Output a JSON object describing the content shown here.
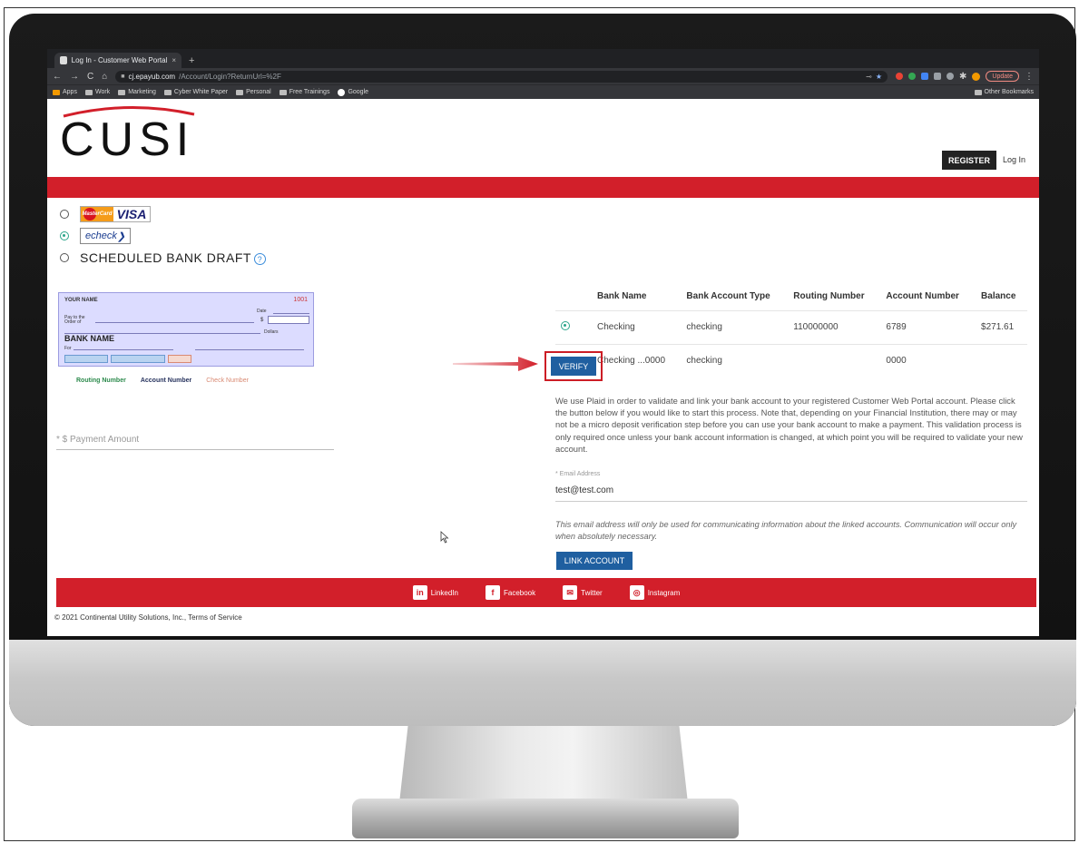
{
  "browser": {
    "tab_title": "Log In - Customer Web Portal",
    "tab_close": "×",
    "new_tab": "+",
    "url_host": "cj.epayub.com",
    "url_path": "/Account/Login?ReturnUrl=%2F",
    "update_label": "Update",
    "bookmarks": [
      "Apps",
      "Work",
      "Marketing",
      "Cyber White Paper",
      "Personal",
      "Free Trainings",
      "Google"
    ],
    "other_bookmarks": "Other Bookmarks"
  },
  "header": {
    "logo_text": "CUSI",
    "register_label": "REGISTER",
    "login_label": "Log In"
  },
  "payment_methods": {
    "card_brand_1": "MasterCard",
    "card_brand_2": "VISA",
    "echeck_label": "echeck",
    "draft_label": "SCHEDULED BANK DRAFT",
    "selected": "echeck"
  },
  "check_image": {
    "name": "YOUR NAME",
    "number": "1001",
    "date_label": "Date",
    "pay_label": "Pay to the Order of",
    "dollars_label": "Dollars",
    "bank_name": "BANK NAME",
    "for_label": "For",
    "legend": {
      "routing": "Routing Number",
      "account": "Account Number",
      "check": "Check Number"
    }
  },
  "payment_amount": {
    "label": "* $  Payment Amount"
  },
  "accounts_table": {
    "columns": [
      "Bank Name",
      "Bank Account Type",
      "Routing Number",
      "Account Number",
      "Balance"
    ],
    "rows": [
      {
        "bank_name": "Checking",
        "type": "checking",
        "routing": "110000000",
        "account": "6789",
        "balance": "$271.61"
      },
      {
        "bank_name": "Checking ...0000",
        "type": "checking",
        "routing": "",
        "account": "0000",
        "balance": ""
      }
    ],
    "verify_label": "VERIFY"
  },
  "plaid": {
    "text": "We use Plaid in order to validate and link your bank account to your registered Customer Web Portal account. Please click the button below if you would like to start this process. Note that, depending on your Financial Institution, there may or may not be a micro deposit verification step before you can use your bank account to make a payment. This validation process is only required once unless your bank account information is changed, at which point you will be required to validate your new account.",
    "email_label": "* Email Address",
    "email_value": "test@test.com",
    "email_note": "This email address will only be used for communicating information about the linked accounts. Communication will occur only when absolutely necessary.",
    "link_label": "LINK ACCOUNT"
  },
  "footer": {
    "social": [
      {
        "icon": "linkedin-icon",
        "label": "LinkedIn"
      },
      {
        "icon": "facebook-icon",
        "label": "Facebook"
      },
      {
        "icon": "twitter-icon",
        "label": "Twitter"
      },
      {
        "icon": "instagram-icon",
        "label": "Instagram"
      }
    ],
    "copyright": "© 2021 Continental Utility Solutions, Inc.,   Terms of Service"
  },
  "colors": {
    "brand_red": "#d21f2a",
    "button_blue": "#1f5fa0",
    "radio_green": "#2ba58a"
  }
}
